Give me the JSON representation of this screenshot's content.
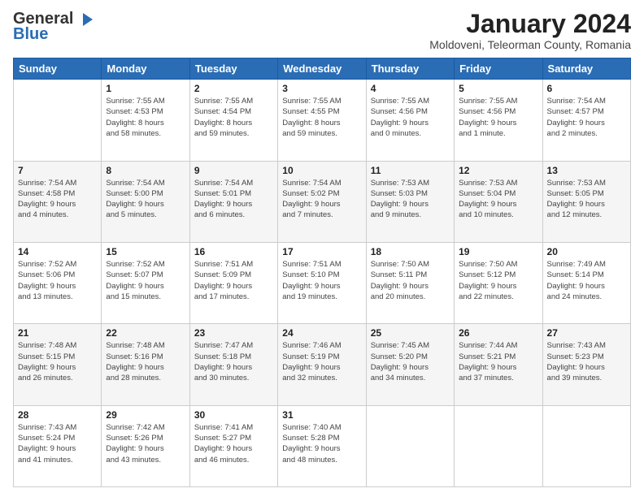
{
  "logo": {
    "general": "General",
    "blue": "Blue"
  },
  "title": "January 2024",
  "location": "Moldoveni, Teleorman County, Romania",
  "weekdays": [
    "Sunday",
    "Monday",
    "Tuesday",
    "Wednesday",
    "Thursday",
    "Friday",
    "Saturday"
  ],
  "weeks": [
    [
      {
        "day": "",
        "info": ""
      },
      {
        "day": "1",
        "info": "Sunrise: 7:55 AM\nSunset: 4:53 PM\nDaylight: 8 hours\nand 58 minutes."
      },
      {
        "day": "2",
        "info": "Sunrise: 7:55 AM\nSunset: 4:54 PM\nDaylight: 8 hours\nand 59 minutes."
      },
      {
        "day": "3",
        "info": "Sunrise: 7:55 AM\nSunset: 4:55 PM\nDaylight: 8 hours\nand 59 minutes."
      },
      {
        "day": "4",
        "info": "Sunrise: 7:55 AM\nSunset: 4:56 PM\nDaylight: 9 hours\nand 0 minutes."
      },
      {
        "day": "5",
        "info": "Sunrise: 7:55 AM\nSunset: 4:56 PM\nDaylight: 9 hours\nand 1 minute."
      },
      {
        "day": "6",
        "info": "Sunrise: 7:54 AM\nSunset: 4:57 PM\nDaylight: 9 hours\nand 2 minutes."
      }
    ],
    [
      {
        "day": "7",
        "info": "Sunrise: 7:54 AM\nSunset: 4:58 PM\nDaylight: 9 hours\nand 4 minutes."
      },
      {
        "day": "8",
        "info": "Sunrise: 7:54 AM\nSunset: 5:00 PM\nDaylight: 9 hours\nand 5 minutes."
      },
      {
        "day": "9",
        "info": "Sunrise: 7:54 AM\nSunset: 5:01 PM\nDaylight: 9 hours\nand 6 minutes."
      },
      {
        "day": "10",
        "info": "Sunrise: 7:54 AM\nSunset: 5:02 PM\nDaylight: 9 hours\nand 7 minutes."
      },
      {
        "day": "11",
        "info": "Sunrise: 7:53 AM\nSunset: 5:03 PM\nDaylight: 9 hours\nand 9 minutes."
      },
      {
        "day": "12",
        "info": "Sunrise: 7:53 AM\nSunset: 5:04 PM\nDaylight: 9 hours\nand 10 minutes."
      },
      {
        "day": "13",
        "info": "Sunrise: 7:53 AM\nSunset: 5:05 PM\nDaylight: 9 hours\nand 12 minutes."
      }
    ],
    [
      {
        "day": "14",
        "info": "Sunrise: 7:52 AM\nSunset: 5:06 PM\nDaylight: 9 hours\nand 13 minutes."
      },
      {
        "day": "15",
        "info": "Sunrise: 7:52 AM\nSunset: 5:07 PM\nDaylight: 9 hours\nand 15 minutes."
      },
      {
        "day": "16",
        "info": "Sunrise: 7:51 AM\nSunset: 5:09 PM\nDaylight: 9 hours\nand 17 minutes."
      },
      {
        "day": "17",
        "info": "Sunrise: 7:51 AM\nSunset: 5:10 PM\nDaylight: 9 hours\nand 19 minutes."
      },
      {
        "day": "18",
        "info": "Sunrise: 7:50 AM\nSunset: 5:11 PM\nDaylight: 9 hours\nand 20 minutes."
      },
      {
        "day": "19",
        "info": "Sunrise: 7:50 AM\nSunset: 5:12 PM\nDaylight: 9 hours\nand 22 minutes."
      },
      {
        "day": "20",
        "info": "Sunrise: 7:49 AM\nSunset: 5:14 PM\nDaylight: 9 hours\nand 24 minutes."
      }
    ],
    [
      {
        "day": "21",
        "info": "Sunrise: 7:48 AM\nSunset: 5:15 PM\nDaylight: 9 hours\nand 26 minutes."
      },
      {
        "day": "22",
        "info": "Sunrise: 7:48 AM\nSunset: 5:16 PM\nDaylight: 9 hours\nand 28 minutes."
      },
      {
        "day": "23",
        "info": "Sunrise: 7:47 AM\nSunset: 5:18 PM\nDaylight: 9 hours\nand 30 minutes."
      },
      {
        "day": "24",
        "info": "Sunrise: 7:46 AM\nSunset: 5:19 PM\nDaylight: 9 hours\nand 32 minutes."
      },
      {
        "day": "25",
        "info": "Sunrise: 7:45 AM\nSunset: 5:20 PM\nDaylight: 9 hours\nand 34 minutes."
      },
      {
        "day": "26",
        "info": "Sunrise: 7:44 AM\nSunset: 5:21 PM\nDaylight: 9 hours\nand 37 minutes."
      },
      {
        "day": "27",
        "info": "Sunrise: 7:43 AM\nSunset: 5:23 PM\nDaylight: 9 hours\nand 39 minutes."
      }
    ],
    [
      {
        "day": "28",
        "info": "Sunrise: 7:43 AM\nSunset: 5:24 PM\nDaylight: 9 hours\nand 41 minutes."
      },
      {
        "day": "29",
        "info": "Sunrise: 7:42 AM\nSunset: 5:26 PM\nDaylight: 9 hours\nand 43 minutes."
      },
      {
        "day": "30",
        "info": "Sunrise: 7:41 AM\nSunset: 5:27 PM\nDaylight: 9 hours\nand 46 minutes."
      },
      {
        "day": "31",
        "info": "Sunrise: 7:40 AM\nSunset: 5:28 PM\nDaylight: 9 hours\nand 48 minutes."
      },
      {
        "day": "",
        "info": ""
      },
      {
        "day": "",
        "info": ""
      },
      {
        "day": "",
        "info": ""
      }
    ]
  ]
}
